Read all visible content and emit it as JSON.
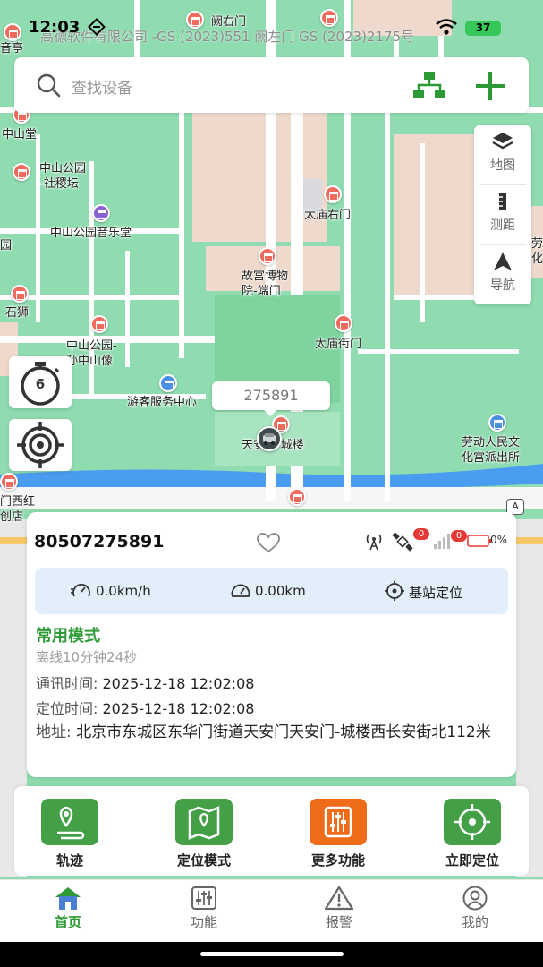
{
  "status_bar": {
    "time": "12:03",
    "battery": "37"
  },
  "map": {
    "copyright": "高德软件有限公司 -GS (2023)551 阙左门 GS (2023)2175号",
    "labels": [
      {
        "id": "poi-wuyou",
        "text": "阙右门"
      },
      {
        "id": "poi-yinyuting",
        "text": "音亭"
      },
      {
        "id": "poi-zhongshantang",
        "text": "中山堂"
      },
      {
        "id": "poi-zhongshangongyuan",
        "text": "中山公园\n-社稷坛"
      },
      {
        "id": "poi-yinyuetang",
        "text": "中山公园音乐堂"
      },
      {
        "id": "poi-taimiaoyoumen",
        "text": "太庙右门"
      },
      {
        "id": "poi-gugong",
        "text": "故宫博物\n院-端门"
      },
      {
        "id": "poi-yuan",
        "text": "园"
      },
      {
        "id": "poi-shishi",
        "text": "石狮"
      },
      {
        "id": "poi-taimiaojiemen",
        "text": "太庙街门"
      },
      {
        "id": "poi-sunzhongshan",
        "text": "中山公园-\n孙中山像"
      },
      {
        "id": "poi-youke",
        "text": "游客服务中心"
      },
      {
        "id": "poi-tiananmen",
        "text": "天安门-城楼"
      },
      {
        "id": "poi-laodong",
        "text": "劳动人民文\n化宫派出所"
      },
      {
        "id": "poi-menxihong",
        "text": "门西红\n创店"
      },
      {
        "id": "poi-lao",
        "text": "劳\n化"
      }
    ],
    "road_badge": "A"
  },
  "search": {
    "placeholder": "查找设备"
  },
  "map_tools": [
    {
      "label": "地图",
      "icon": "layers-icon"
    },
    {
      "label": "测距",
      "icon": "ruler-icon"
    },
    {
      "label": "导航",
      "icon": "navigate-icon"
    }
  ],
  "timer_value": "6",
  "vehicle": {
    "bubble_text": "275891"
  },
  "device": {
    "id": "80507275891",
    "signal_badge": "0",
    "satellite_badge": "0",
    "battery_pct": "0%",
    "speed": "0.0km/h",
    "mileage": "0.00km",
    "location_type": "基站定位",
    "mode": "常用模式",
    "offline": "离线10分钟24秒",
    "comm_time_label": "通讯时间:",
    "comm_time": "2025-12-18 12:02:08",
    "loc_time_label": "定位时间:",
    "loc_time": "2025-12-18 12:02:08",
    "address_label": "地址:",
    "address": "北京市东城区东华门街道天安门天安门-城楼西长安街北112米"
  },
  "actions": [
    {
      "label": "轨迹",
      "color": "#43a047"
    },
    {
      "label": "定位模式",
      "color": "#43a047"
    },
    {
      "label": "更多功能",
      "color": "#ef6c1a"
    },
    {
      "label": "立即定位",
      "color": "#43a047"
    }
  ],
  "tabs": [
    {
      "label": "首页",
      "active": true
    },
    {
      "label": "功能",
      "active": false
    },
    {
      "label": "报警",
      "active": false
    },
    {
      "label": "我的",
      "active": false
    }
  ],
  "colors": {
    "accent": "#2e9a35",
    "map_green": "#8fdcb0",
    "road": "#ffffff",
    "water": "#4a9cf0"
  }
}
